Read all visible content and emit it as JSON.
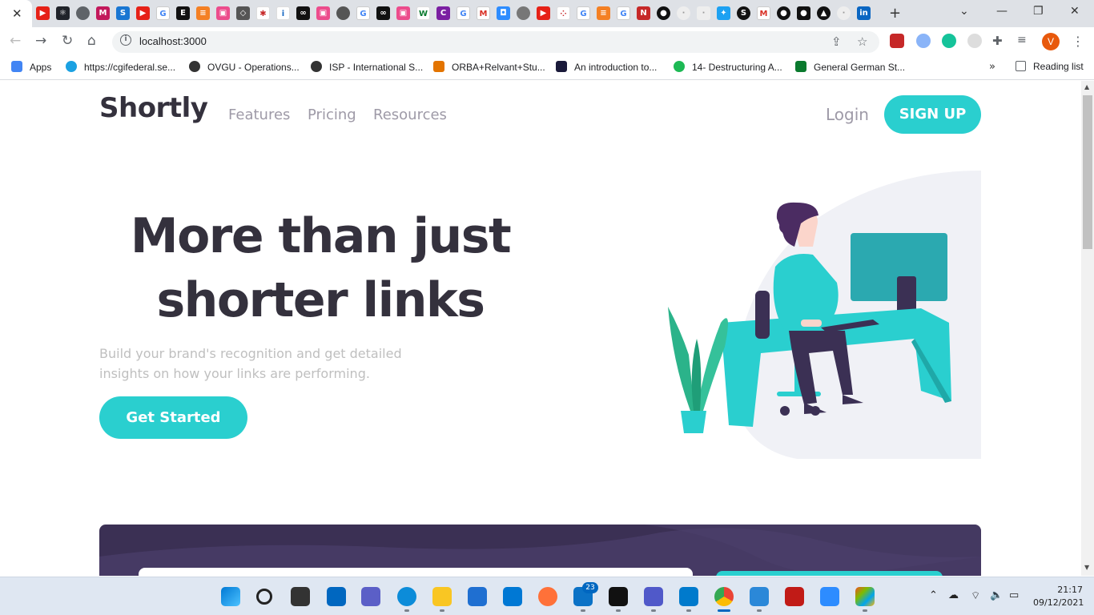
{
  "browser": {
    "tab_close_glyph": "✕",
    "new_tab_glyph": "+",
    "window_controls": [
      "⌄",
      "—",
      "❐",
      "✕"
    ],
    "url": "localhost:3000",
    "profile_initial": "V",
    "bookmarks": [
      {
        "label": "Apps",
        "color": "#4285f4"
      },
      {
        "label": "https://cgifederal.se...",
        "color": "#1ba1e2"
      },
      {
        "label": "OVGU - Operations...",
        "color": "#333333"
      },
      {
        "label": "ISP - International S...",
        "color": "#333333"
      },
      {
        "label": "ORBA+Relvant+Stu...",
        "color": "#e37400"
      },
      {
        "label": "An introduction to...",
        "color": "#1a1a3a"
      },
      {
        "label": "14- Destructuring A...",
        "color": "#1db954"
      },
      {
        "label": "General German St...",
        "color": "#0a7a2e"
      }
    ],
    "bookmarks_more": "»",
    "reading_list": "Reading list"
  },
  "site": {
    "logo": "Shortly",
    "nav": [
      "Features",
      "Pricing",
      "Resources"
    ],
    "login": "Login",
    "signup": "SIGN UP",
    "hero_title_line1": "More than just",
    "hero_title_line2": "shorter links",
    "hero_subtitle": "Build your brand's recognition and get detailed insights on how your links are performing.",
    "cta": "Get Started"
  },
  "taskbar": {
    "badge_count": "23",
    "time": "21:17",
    "date": "09/12/2021"
  },
  "colors": {
    "cyan": "#2acfcf",
    "dark_violet": "#3b3054",
    "text_dark": "#34313d",
    "gray": "#9e9aa7"
  }
}
